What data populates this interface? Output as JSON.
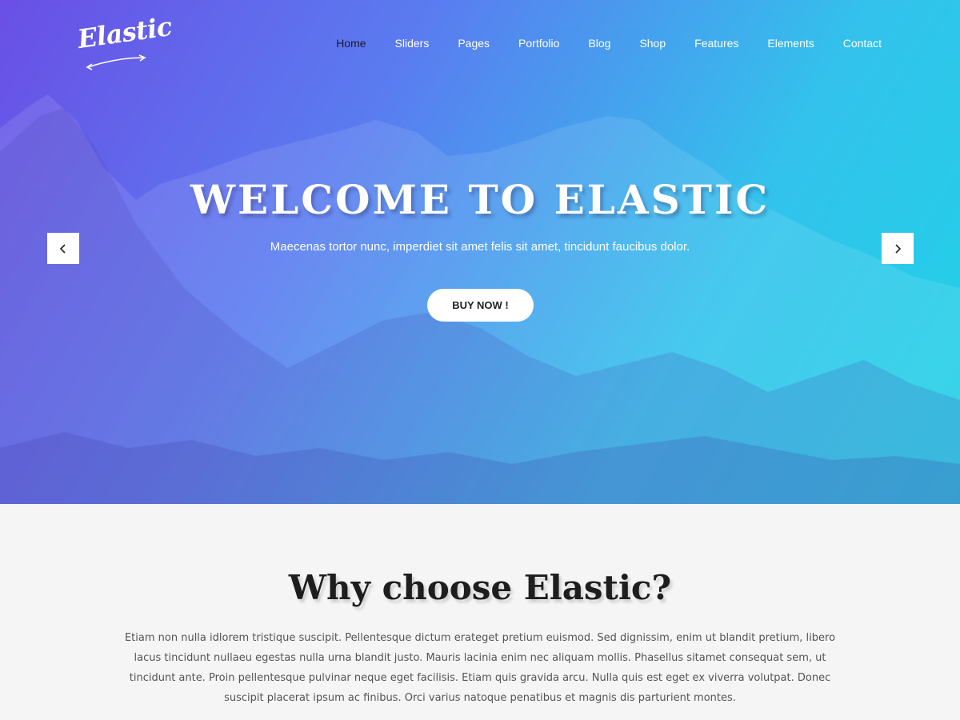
{
  "logo": {
    "text": "Elastic"
  },
  "nav": {
    "items": [
      "Home",
      "Sliders",
      "Pages",
      "Portfolio",
      "Blog",
      "Shop",
      "Features",
      "Elements",
      "Contact"
    ]
  },
  "hero": {
    "title": "WELCOME TO ELASTIC",
    "subtitle": "Maecenas tortor nunc, imperdiet sit amet felis sit amet, tincidunt faucibus dolor.",
    "button": "BUY NOW !",
    "prev_icon": "chevron-left-icon",
    "next_icon": "chevron-right-icon"
  },
  "why": {
    "title": "Why choose Elastic?",
    "text": "Etiam non nulla idlorem tristique suscipit. Pellentesque dictum erateget pretium euismod. Sed dignissim, enim ut blandit pretium, libero lacus tincidunt nullaeu egestas nulla urna blandit justo. Mauris lacinia enim nec aliquam mollis. Phasellus sitamet consequat sem, ut tincidunt ante. Proin pellentesque pulvinar neque eget facilisis. Etiam quis gravida arcu. Nulla quis est eget ex viverra volutpat. Donec suscipit placerat ipsum ac finibus. Orci varius natoque penatibus et magnis dis parturient montes."
  },
  "colors": {
    "gradient_start": "#6a4fe6",
    "gradient_end": "#1fd2e6",
    "section_bg": "#f5f5f5"
  }
}
